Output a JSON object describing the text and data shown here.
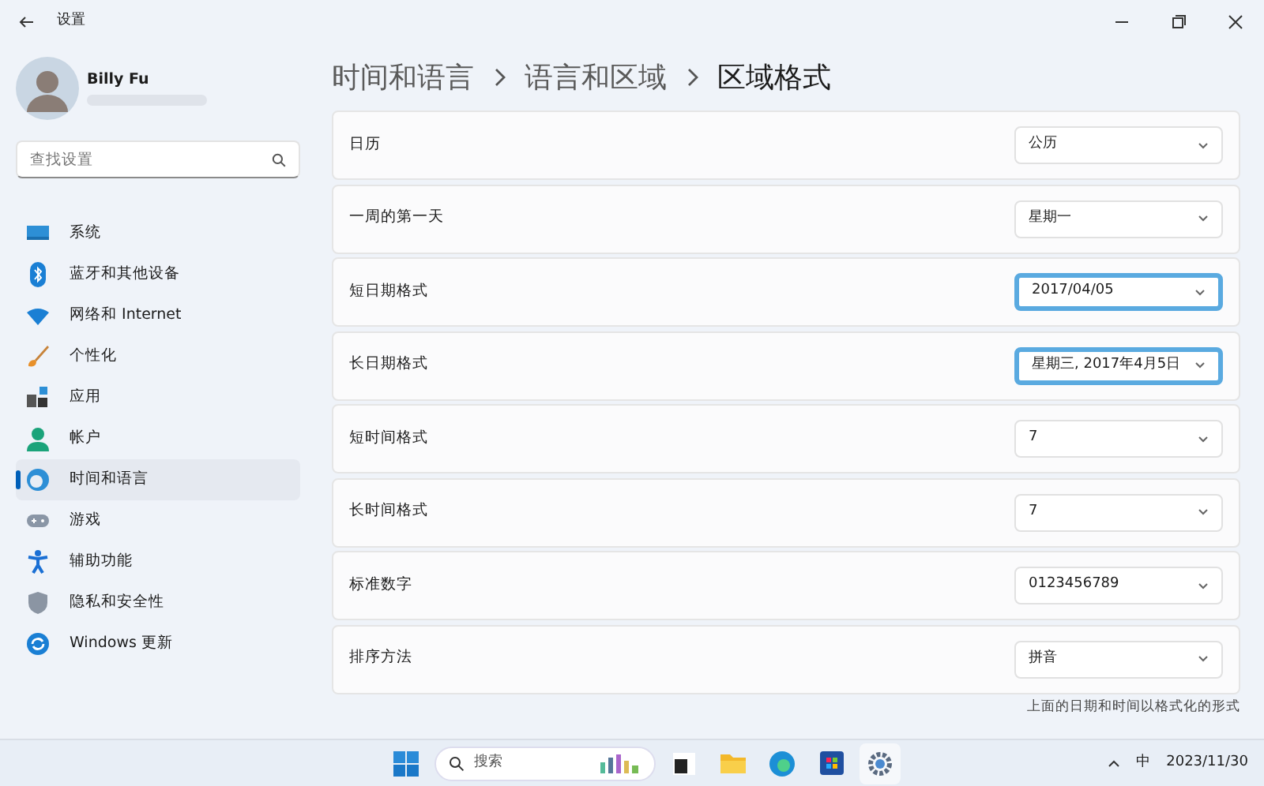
{
  "window": {
    "title": "设置"
  },
  "user": {
    "name": "Billy Fu"
  },
  "search": {
    "placeholder": "查找设置"
  },
  "sidebar": {
    "items": [
      {
        "label": "系统",
        "selected": false
      },
      {
        "label": "蓝牙和其他设备",
        "selected": false
      },
      {
        "label": "网络和 Internet",
        "selected": false
      },
      {
        "label": "个性化",
        "selected": false
      },
      {
        "label": "应用",
        "selected": false
      },
      {
        "label": "帐户",
        "selected": false
      },
      {
        "label": "时间和语言",
        "selected": true
      },
      {
        "label": "游戏",
        "selected": false
      },
      {
        "label": "辅助功能",
        "selected": false
      },
      {
        "label": "隐私和安全性",
        "selected": false
      },
      {
        "label": "Windows 更新",
        "selected": false
      }
    ]
  },
  "breadcrumb": [
    "时间和语言",
    "语言和区域",
    "区域格式"
  ],
  "settings": [
    {
      "label": "日历",
      "value": "公历",
      "highlighted": false
    },
    {
      "label": "一周的第一天",
      "value": "星期一",
      "highlighted": false
    },
    {
      "label": "短日期格式",
      "value": "2017/04/05",
      "highlighted": true
    },
    {
      "label": "长日期格式",
      "value": "星期三, 2017年4月5日",
      "highlighted": true
    },
    {
      "label": "短时间格式",
      "value": "7",
      "highlighted": false
    },
    {
      "label": "长时间格式",
      "value": "7",
      "highlighted": false
    },
    {
      "label": "标准数字",
      "value": "0123456789",
      "highlighted": false
    },
    {
      "label": "排序方法",
      "value": "拼音",
      "highlighted": false
    }
  ],
  "footnote": "上面的日期和时间以格式化的形式",
  "taskbar": {
    "search_placeholder": "搜索",
    "ime": "中",
    "date": "2023/11/30"
  }
}
